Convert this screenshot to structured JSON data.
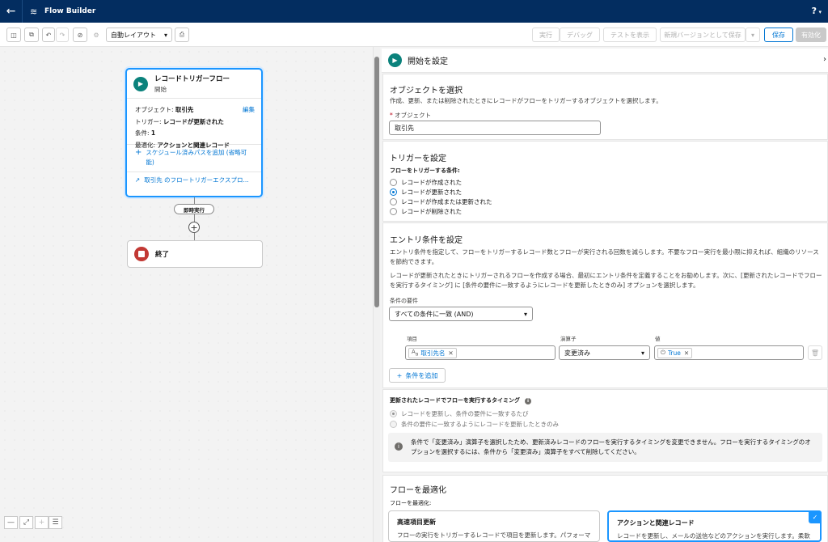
{
  "app": {
    "title": "Flow Builder",
    "help": "?"
  },
  "toolbar": {
    "layout_select": "自動レイアウト",
    "run": "実行",
    "debug": "デバッグ",
    "view_tests": "テストを表示",
    "save_new_version": "新規バージョンとして保存",
    "save": "保存",
    "activate": "有効化"
  },
  "canvas": {
    "start": {
      "title": "レコードトリガーフロー",
      "subtitle": "開始",
      "object_label": "オブジェクト: ",
      "object_value": "取引先",
      "edit": "編集",
      "trigger_label": "トリガー: ",
      "trigger_value": "レコードが更新された",
      "conditions_label": "条件: ",
      "conditions_value": "1",
      "optimize_label": "最適化: ",
      "optimize_value": "アクションと関連レコード",
      "add_scheduled_path": "スケジュール済みパスを追加 (省略可能)",
      "explorer_link": "取引先 のフロートリガーエクスプロ..."
    },
    "immediate": "即時実行",
    "end": "終了"
  },
  "panel": {
    "title": "開始を設定",
    "object_section": {
      "title": "オブジェクトを選択",
      "desc": "作成、更新、または削除されたときにレコードがフローをトリガーするオブジェクトを選択します。",
      "object_label": "オブジェクト",
      "object_value": "取引先"
    },
    "trigger_section": {
      "title": "トリガーを設定",
      "label": "フローをトリガーする条件:",
      "options": [
        "レコードが作成された",
        "レコードが更新された",
        "レコードが作成または更新された",
        "レコードが削除された"
      ]
    },
    "entry_section": {
      "title": "エントリ条件を設定",
      "desc1": "エントリ条件を指定して、フローをトリガーするレコード数とフローが実行される回数を減らします。不要なフロー実行を最小限に抑えれば、組織のリソースを節約できます。",
      "desc2": "レコードが更新されたときにトリガーされるフローを作成する場合、最初にエントリ条件を定義することをお勧めします。次に、[更新されたレコードでフローを実行するタイミング] に [条件の要件に一致するようにレコードを更新したときのみ] オプションを選択します。",
      "req_label": "条件の要件",
      "req_value": "すべての条件に一致 (AND)",
      "field_label": "項目",
      "operator_label": "演算子",
      "value_label": "値",
      "field_value": "取引先名",
      "operator_value": "変更済み",
      "value_value": "True",
      "add_condition": "条件を追加"
    },
    "timing_section": {
      "title": "更新されたレコードでフローを実行するタイミング",
      "options": [
        "レコードを更新し、条件の要件に一致するたび",
        "条件の要件に一致するようにレコードを更新したときのみ"
      ],
      "info": "条件で「変更済み」演算子を選択したため、更新済みレコードのフローを実行するタイミングを変更できません。フローを実行するタイミングのオプションを選択するには、条件から「変更済み」演算子をすべて削除してください。"
    },
    "optimize_section": {
      "title": "フローを最適化",
      "label": "フローを最適化:",
      "card1_title": "高速項目更新",
      "card1_desc": "フローの実行をトリガーするレコードで項目を更新します。パフォーマンス",
      "card2_title": "アクションと関連レコード",
      "card2_desc": "レコードを更新し、メールの送信などのアクションを実行します。柔軟"
    }
  }
}
